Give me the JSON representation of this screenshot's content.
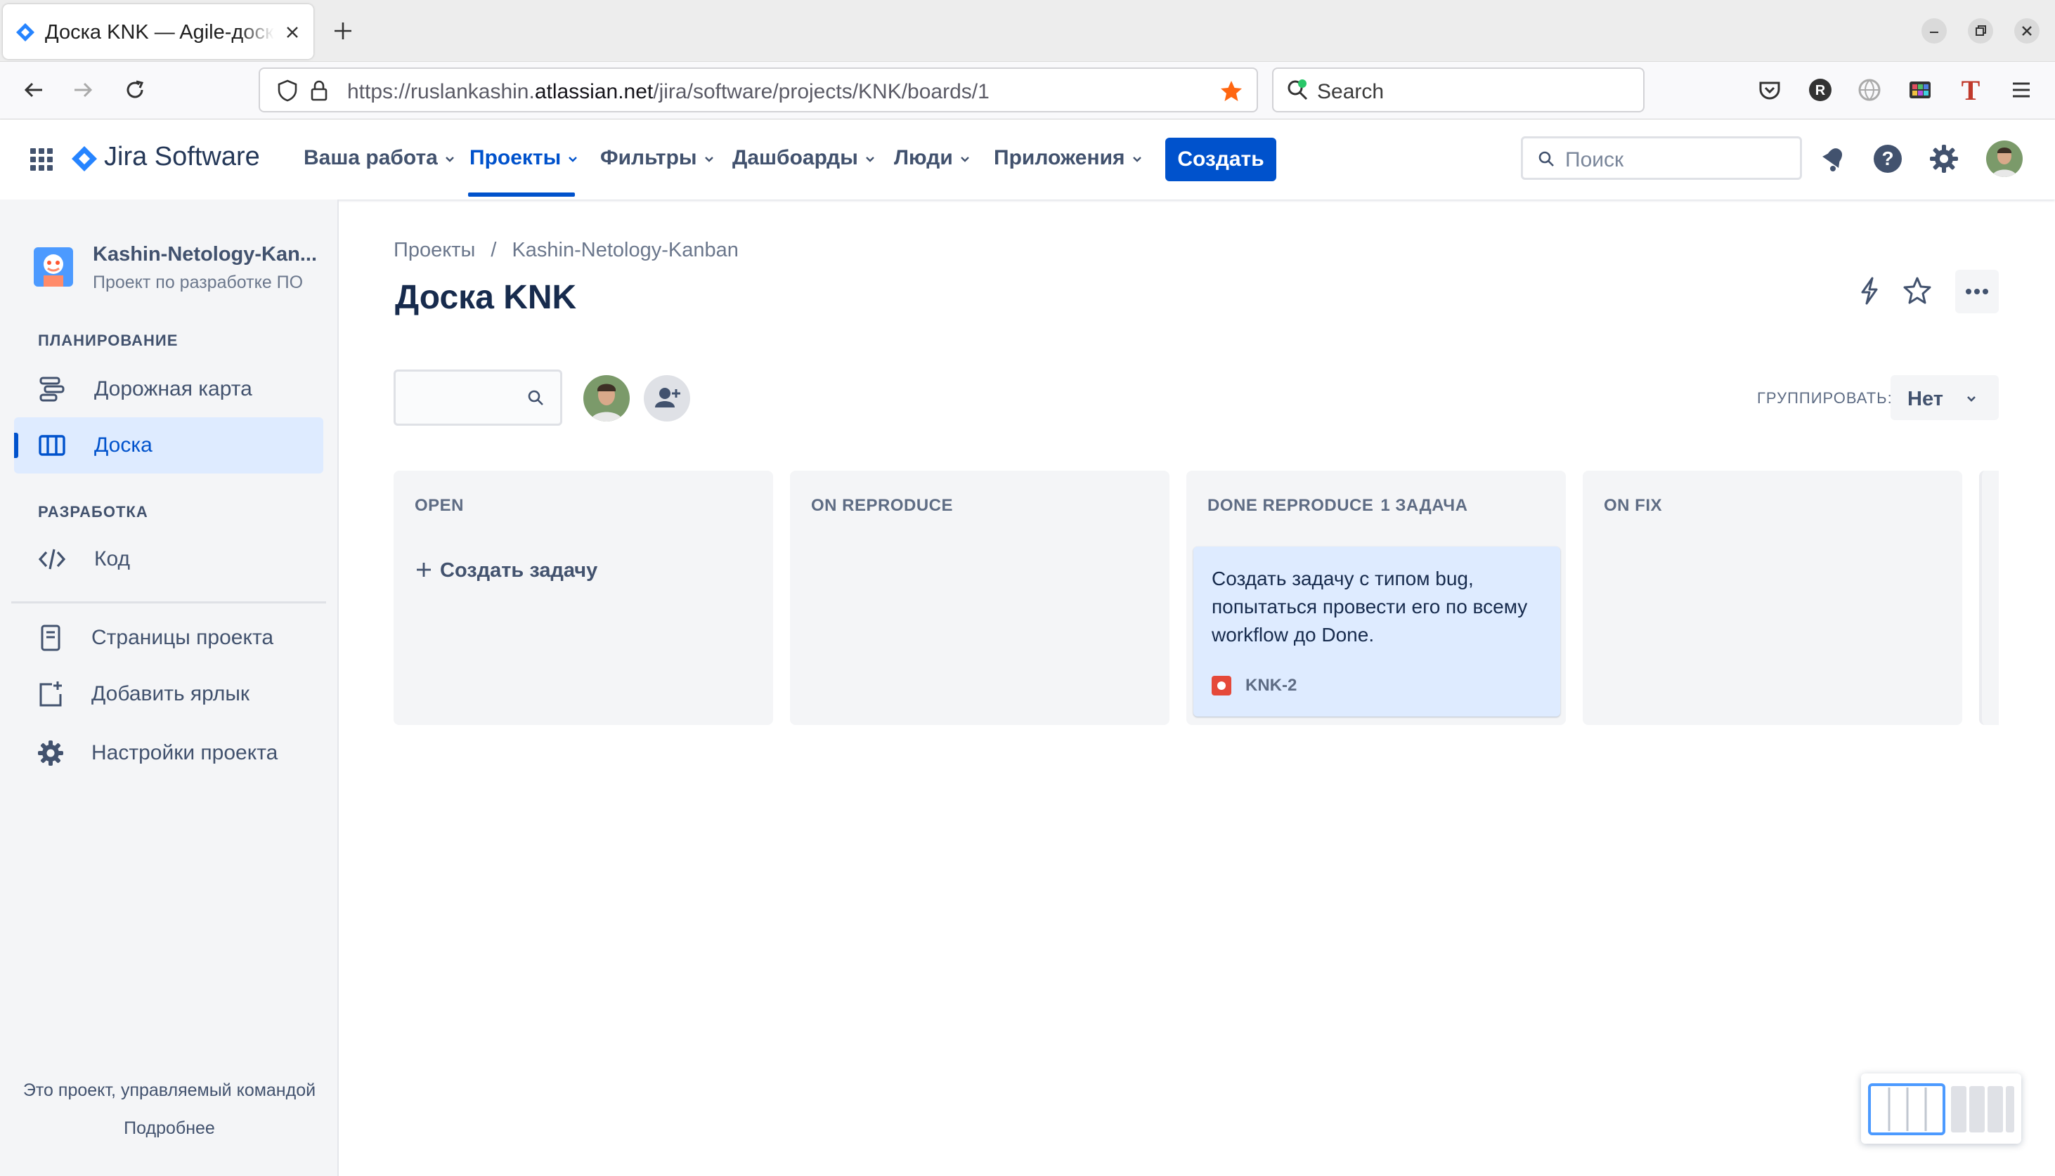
{
  "browser": {
    "tab_title": "Доска KNK — Agile-доска",
    "url_prefix": "https://ruslankashin.",
    "url_domain": "atlassian.net",
    "url_path": "/jira/software/projects/KNK/boards/1",
    "search_placeholder": "Search"
  },
  "jira_nav": {
    "product": "Jira Software",
    "menu": [
      "Ваша работа",
      "Проекты",
      "Фильтры",
      "Дашбоарды",
      "Люди",
      "Приложения"
    ],
    "active_menu": "Проекты",
    "create_label": "Создать",
    "search_placeholder": "Поиск",
    "accent": "#0052cc"
  },
  "sidebar": {
    "project_name": "Kashin-Netology-Kan...",
    "project_type": "Проект по разработке ПО",
    "planning_header": "ПЛАНИРОВАНИЕ",
    "planning_items": [
      {
        "label": "Дорожная карта",
        "icon": "roadmap-icon"
      },
      {
        "label": "Доска",
        "icon": "board-icon",
        "active": true
      }
    ],
    "dev_header": "РАЗРАБОТКА",
    "dev_items": [
      {
        "label": "Код",
        "icon": "code-icon"
      }
    ],
    "extra_items": [
      {
        "label": "Страницы проекта",
        "icon": "pages-icon"
      },
      {
        "label": "Добавить ярлык",
        "icon": "add-shortcut-icon"
      },
      {
        "label": "Настройки проекта",
        "icon": "gear-icon"
      }
    ],
    "footer_text": "Это проект, управляемый командой",
    "footer_link": "Подробнее"
  },
  "board": {
    "breadcrumb": [
      "Проекты",
      "Kashin-Netology-Kanban"
    ],
    "title": "Доска KNK",
    "group_label": "ГРУППИРОВАТЬ:",
    "group_value": "Нет",
    "columns": [
      {
        "title": "OPEN",
        "count": "",
        "create_task": "Создать задачу"
      },
      {
        "title": "ON REPRODUCE",
        "count": ""
      },
      {
        "title": "DONE REPRODUCE",
        "count": "1 ЗАДАЧА",
        "card": {
          "summary": "Создать задачу с типом bug, попытаться провести его по всему workflow до Done.",
          "key": "KNK-2",
          "type_icon": "bug-icon",
          "type_color": "#e5493a"
        }
      },
      {
        "title": "ON FIX",
        "count": ""
      }
    ]
  }
}
